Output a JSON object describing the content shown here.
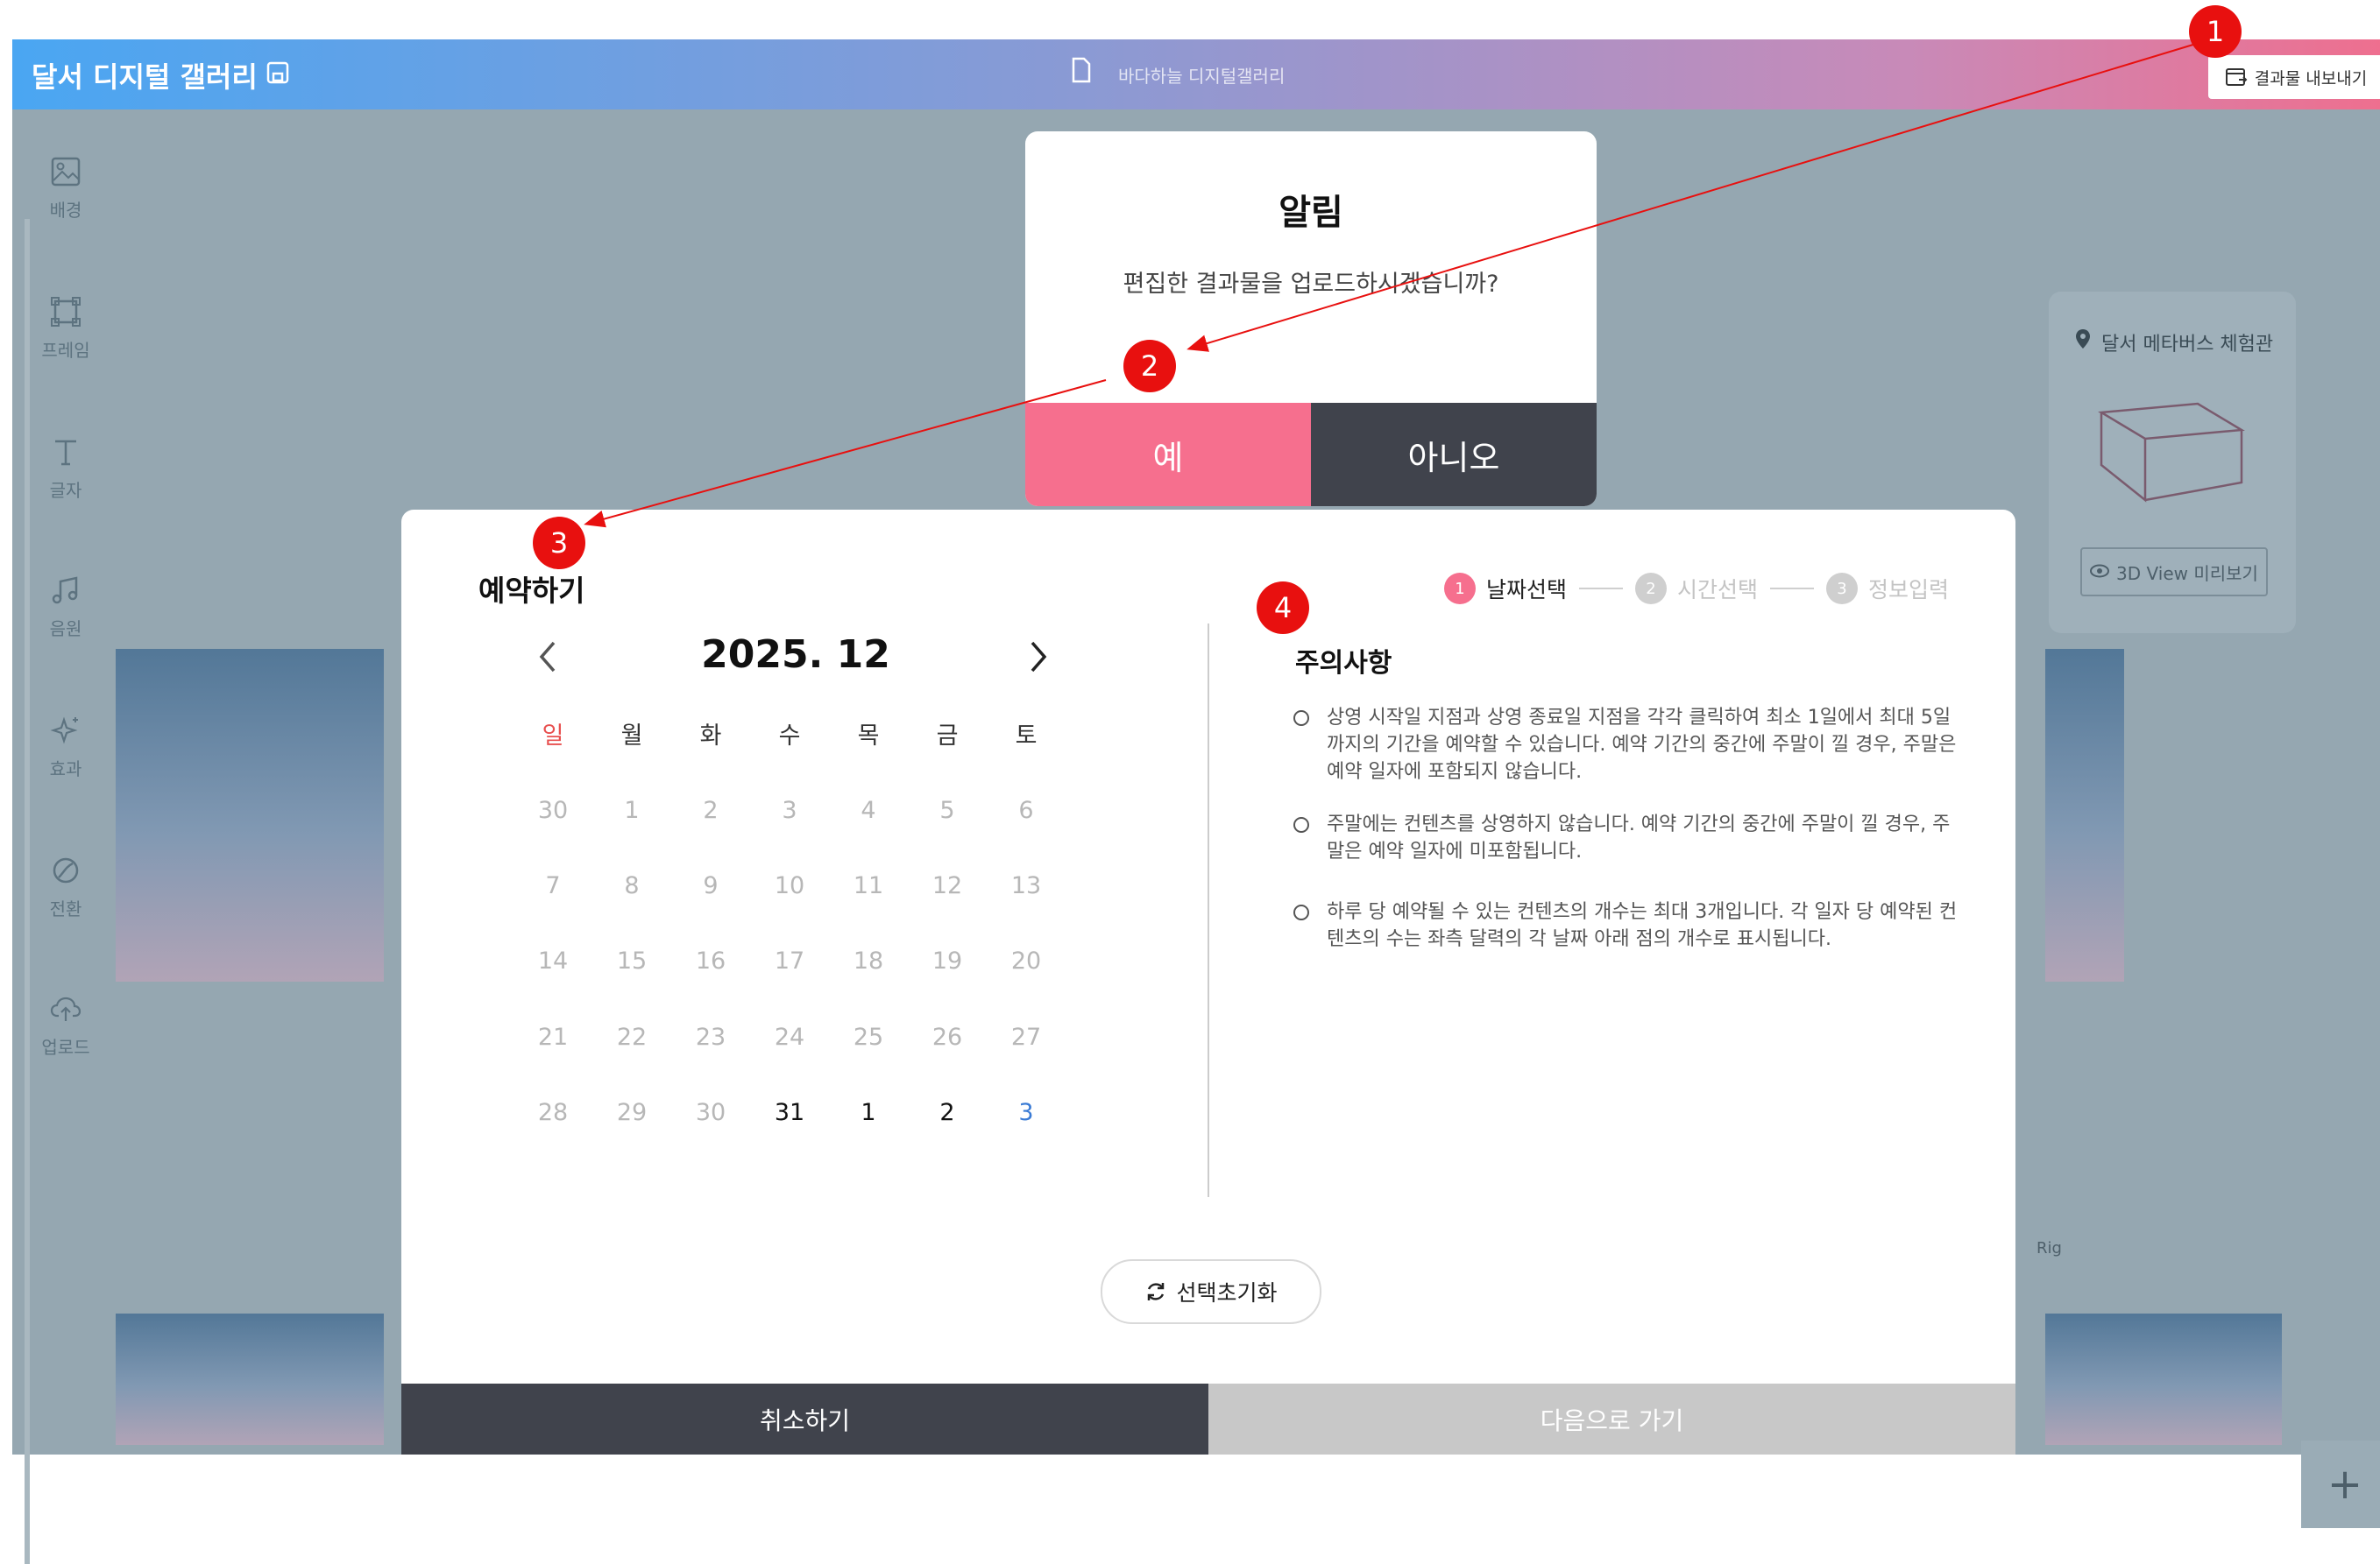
{
  "app": {
    "title": "달서 디지털 갤러리",
    "doc_title": "바다하늘 디지털갤러리",
    "export_label": "결과물 내보내기"
  },
  "tools": [
    {
      "label": "배경",
      "icon": "image-icon"
    },
    {
      "label": "프레임",
      "icon": "frame-icon"
    },
    {
      "label": "글자",
      "icon": "text-icon"
    },
    {
      "label": "음원",
      "icon": "music-icon"
    },
    {
      "label": "효과",
      "icon": "sparkle-icon"
    },
    {
      "label": "전환",
      "icon": "transition-icon"
    },
    {
      "label": "업로드",
      "icon": "upload-icon"
    }
  ],
  "right_card": {
    "title": "달서 메타버스 체험관",
    "button": "3D View 미리보기"
  },
  "background_labels": {
    "rig": "Rig",
    "plus": "+"
  },
  "alert": {
    "title": "알림",
    "message": "편집한 결과물을 업로드하시겠습니까?",
    "yes": "예",
    "no": "아니오"
  },
  "reservation": {
    "title": "예약하기",
    "steps": [
      {
        "num": "1",
        "label": "날짜선택",
        "active": true
      },
      {
        "num": "2",
        "label": "시간선택",
        "active": false
      },
      {
        "num": "3",
        "label": "정보입력",
        "active": false
      }
    ],
    "calendar": {
      "month": "2025. 12",
      "weekdays": [
        "일",
        "월",
        "화",
        "수",
        "목",
        "금",
        "토"
      ],
      "weeks": [
        [
          "30",
          "1",
          "2",
          "3",
          "4",
          "5",
          "6"
        ],
        [
          "7",
          "8",
          "9",
          "10",
          "11",
          "12",
          "13"
        ],
        [
          "14",
          "15",
          "16",
          "17",
          "18",
          "19",
          "20"
        ],
        [
          "21",
          "22",
          "23",
          "24",
          "25",
          "26",
          "27"
        ],
        [
          "28",
          "29",
          "30",
          "31",
          "1",
          "2",
          "3"
        ]
      ],
      "active_days": [
        "31",
        "1",
        "2",
        "3"
      ]
    },
    "notice": {
      "title": "주의사항",
      "items": [
        "상영 시작일 지점과 상영 종료일 지점을 각각 클릭하여 최소 1일에서 최대 5일까지의 기간을 예약할 수 있습니다. 예약 기간의 중간에 주말이 낄 경우, 주말은 예약 일자에 포함되지 않습니다.",
        "주말에는 컨텐츠를 상영하지 않습니다. 예약 기간의 중간에 주말이 낄 경우, 주말은 예약 일자에 미포함됩니다.",
        "하루 당 예약될 수 있는 컨텐츠의 개수는 최대 3개입니다. 각 일자 당 예약된 컨텐츠의 수는 좌측 달력의 각 날짜 아래 점의 개수로 표시됩니다."
      ]
    },
    "reset": "선택초기화",
    "cancel": "취소하기",
    "next": "다음으로 가기"
  },
  "annotations": [
    "1",
    "2",
    "3",
    "4"
  ],
  "colors": {
    "accent": "#f66f8e",
    "dark": "#40434c",
    "disabled": "#c8c8c8",
    "annotation": "#e8100f",
    "sunday": "#e8504f",
    "saturday": "#3a7bd5"
  }
}
